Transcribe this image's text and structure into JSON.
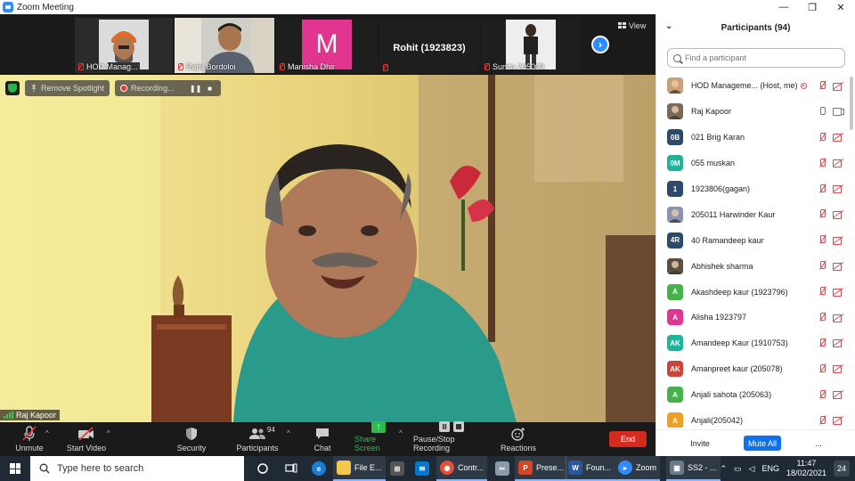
{
  "window": {
    "title": "Zoom Meeting",
    "minimize": "—",
    "maximize": "❐",
    "close": "✕"
  },
  "strip": {
    "thumbs": [
      {
        "name": "HOD Manag..."
      },
      {
        "name": "Rajiv Bordoloi"
      },
      {
        "name": "Manisha Dhir",
        "initial": "M"
      },
      {
        "name": "Rohit (1923823)"
      },
      {
        "name": "Sunita 205009"
      }
    ],
    "view_label": "View",
    "next_label": "›"
  },
  "overlay": {
    "remove_spotlight": "Remove Spotlight",
    "recording": "Recording...",
    "pause": "❚❚",
    "stop": "■"
  },
  "speaker": {
    "name": "Raj Kapoor"
  },
  "controls": {
    "unmute": "Unmute",
    "start_video": "Start Video",
    "security": "Security",
    "participants": "Participants",
    "participants_count": "94",
    "chat": "Chat",
    "share_screen": "Share Screen",
    "pause_stop_recording": "Pause/Stop Recording",
    "reactions": "Reactions",
    "end": "End",
    "caret": "^"
  },
  "panel": {
    "title": "Participants (94)",
    "collapse": "⌄",
    "search_placeholder": "Find a participant",
    "participants": [
      {
        "name": "HOD Manageme... (Host, me)",
        "initials": "",
        "color": "#c9a27a",
        "photo": true,
        "host": true,
        "mic": "muted",
        "cam": "off"
      },
      {
        "name": "Raj Kapoor",
        "initials": "",
        "color": "#7a6a5a",
        "photo": true,
        "host": false,
        "mic": "on",
        "cam": "on"
      },
      {
        "name": "021 Brig Karan",
        "initials": "0B",
        "color": "#2e4a6b",
        "photo": false,
        "host": false,
        "mic": "muted",
        "cam": "off"
      },
      {
        "name": "055 muskan",
        "initials": "0M",
        "color": "#1fb39a",
        "photo": false,
        "host": false,
        "mic": "muted",
        "cam": "off"
      },
      {
        "name": "1923806(gagan)",
        "initials": "1",
        "color": "#2e4a6b",
        "photo": false,
        "host": false,
        "mic": "muted",
        "cam": "off"
      },
      {
        "name": "205011 Harwinder Kaur",
        "initials": "",
        "color": "#8a95b5",
        "photo": true,
        "host": false,
        "mic": "muted",
        "cam": "off"
      },
      {
        "name": "40 Ramandeep kaur",
        "initials": "4R",
        "color": "#2e4a6b",
        "photo": false,
        "host": false,
        "mic": "muted",
        "cam": "off"
      },
      {
        "name": "Abhishek sharma",
        "initials": "",
        "color": "#5a5040",
        "photo": true,
        "host": false,
        "mic": "muted",
        "cam": "off"
      },
      {
        "name": "Akashdeep kaur (1923796)",
        "initials": "A",
        "color": "#47b14b",
        "photo": false,
        "host": false,
        "mic": "muted",
        "cam": "off"
      },
      {
        "name": "Alisha 1923797",
        "initials": "A",
        "color": "#e0368f",
        "photo": false,
        "host": false,
        "mic": "muted",
        "cam": "off"
      },
      {
        "name": "Amandeep Kaur (1910753)",
        "initials": "AK",
        "color": "#1fb39a",
        "photo": false,
        "host": false,
        "mic": "muted",
        "cam": "off"
      },
      {
        "name": "Amanpreet kaur (205078)",
        "initials": "AK",
        "color": "#c9453a",
        "photo": false,
        "host": false,
        "mic": "muted",
        "cam": "off"
      },
      {
        "name": "Anjali sahota (205063)",
        "initials": "A",
        "color": "#47b14b",
        "photo": false,
        "host": false,
        "mic": "muted",
        "cam": "off"
      },
      {
        "name": "Anjali(205042)",
        "initials": "A",
        "color": "#f0a020",
        "photo": false,
        "host": false,
        "mic": "muted",
        "cam": "off"
      }
    ],
    "invite": "Invite",
    "mute_all": "Mute All",
    "more": "..."
  },
  "taskbar": {
    "search_placeholder": "Type here to search",
    "apps": [
      {
        "label": "File E...",
        "icon": "folder-icon",
        "color": "#f2c94c"
      },
      {
        "label": "Contr...",
        "icon": "chrome-icon",
        "color": "#e44d3a"
      },
      {
        "label": "Prese...",
        "icon": "powerpoint-icon",
        "color": "#d24726"
      },
      {
        "label": "Foun...",
        "icon": "word-icon",
        "color": "#2b579a"
      },
      {
        "label": "Zoom",
        "icon": "zoom-icon",
        "color": "#2d8cff"
      },
      {
        "label": "SS2 - ...",
        "icon": "snip-icon",
        "color": "#6a7a8a"
      }
    ],
    "lang": "ENG",
    "time": "11:47",
    "date": "18/02/2021",
    "notifications": "24"
  }
}
